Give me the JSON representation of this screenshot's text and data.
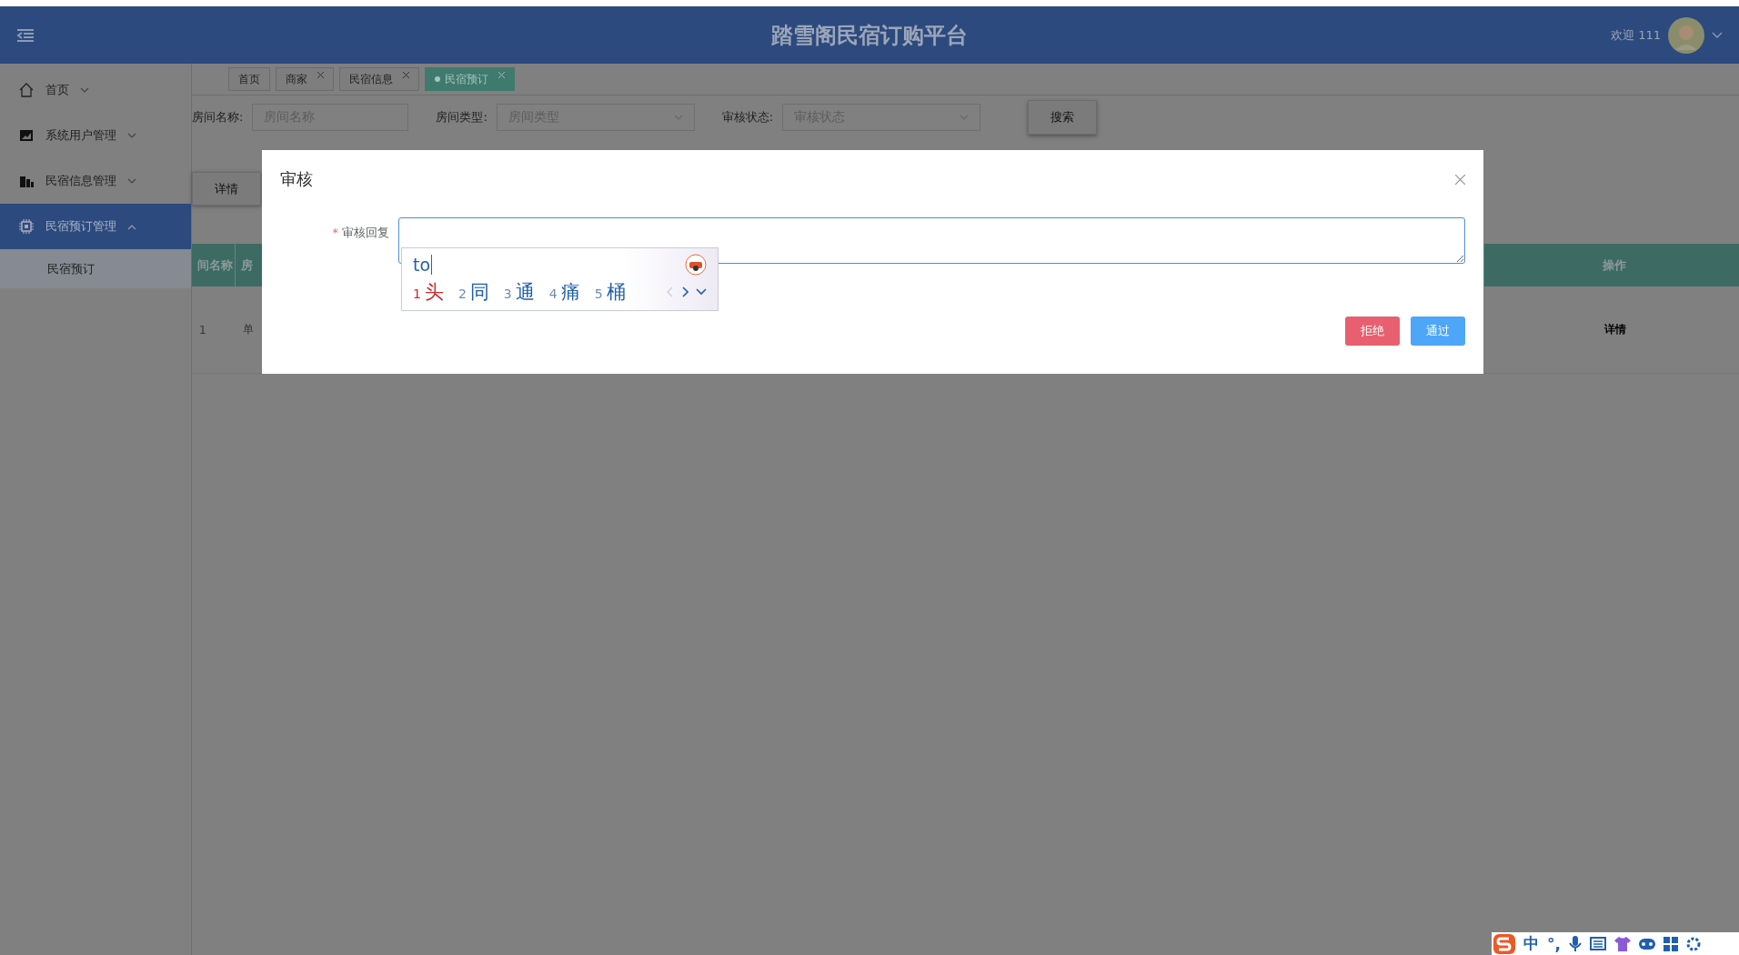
{
  "header": {
    "title": "踏雪阁民宿订购平台",
    "welcome": "欢迎 111"
  },
  "sidebar": {
    "items": [
      {
        "label": "首页",
        "expanded": false,
        "selected": false
      },
      {
        "label": "系统用户管理",
        "expanded": false,
        "selected": false
      },
      {
        "label": "民宿信息管理",
        "expanded": false,
        "selected": false
      },
      {
        "label": "民宿预订管理",
        "expanded": true,
        "selected": true,
        "children": [
          {
            "label": "民宿预订",
            "selected": false
          }
        ]
      }
    ]
  },
  "tabs": [
    {
      "label": "首页",
      "closable": false,
      "selected": false
    },
    {
      "label": "商家",
      "closable": true,
      "selected": false
    },
    {
      "label": "民宿信息",
      "closable": true,
      "selected": false
    },
    {
      "label": "民宿预订",
      "closable": true,
      "selected": true
    }
  ],
  "search": {
    "fields": [
      {
        "label": "房间名称:",
        "placeholder": "房间名称",
        "kind": "input"
      },
      {
        "label": "房间类型:",
        "placeholder": "房间类型",
        "kind": "select"
      },
      {
        "label": "审核状态:",
        "placeholder": "审核状态",
        "kind": "select"
      }
    ],
    "button": "搜索"
  },
  "detail_button": "详情",
  "table": {
    "columns": [
      "间名称",
      "房",
      "操作"
    ],
    "rows": [
      {
        "cells": [
          "1",
          "单",
          "详情"
        ]
      }
    ]
  },
  "dialog": {
    "title": "审核",
    "field": {
      "label": "审核回复",
      "required_mark": "*"
    },
    "buttons": [
      {
        "label": "拒绝",
        "kind": "danger"
      },
      {
        "label": "通过",
        "kind": "primary"
      }
    ]
  },
  "ime": {
    "composition": "to",
    "candidates": [
      {
        "index": "1",
        "text": "头",
        "selected": true
      },
      {
        "index": "2",
        "text": "同",
        "selected": false
      },
      {
        "index": "3",
        "text": "通",
        "selected": false
      },
      {
        "index": "4",
        "text": "痛",
        "selected": false
      },
      {
        "index": "5",
        "text": "桶",
        "selected": false
      }
    ]
  },
  "ime_toolbar": {
    "mode": "中",
    "punctuation": "°,"
  }
}
